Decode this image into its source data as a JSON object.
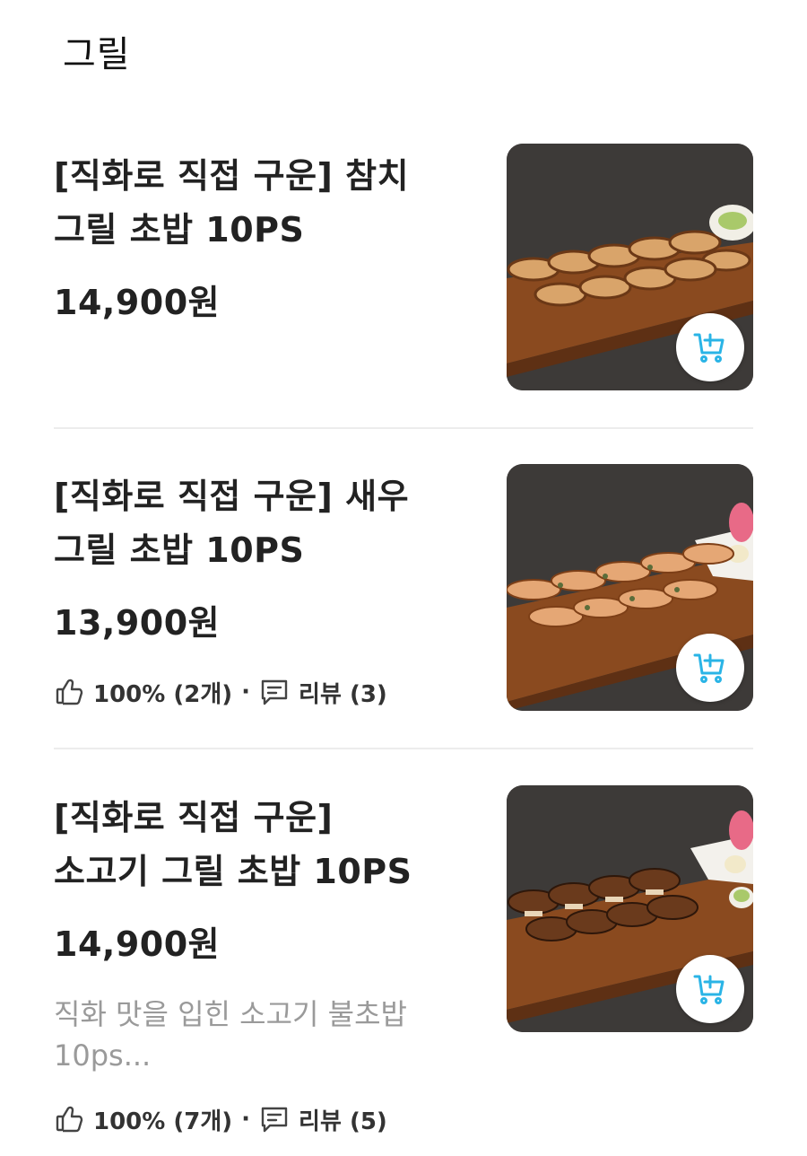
{
  "section": {
    "title": "그릴"
  },
  "colors": {
    "accent": "#2ab4e6",
    "text": "#222222",
    "muted": "#9a9a9a",
    "divider": "#ececec"
  },
  "items": [
    {
      "name_lines": [
        "[직화로 직접 구운] 참치",
        "그릴 초밥 10PS"
      ],
      "price": "14,900원",
      "image": "tuna-grill-sushi-photo"
    },
    {
      "name_lines": [
        "[직화로 직접 구운] 새우",
        "그릴 초밥 10PS"
      ],
      "price": "13,900원",
      "rating": "100% (2개)",
      "reviews": "리뷰 (3)",
      "image": "shrimp-grill-sushi-photo"
    },
    {
      "name_lines": [
        "[직화로 직접 구운]",
        "소고기 그릴 초밥 10PS"
      ],
      "price": "14,900원",
      "description_lines": [
        "직화 맛을 입힌 소고기 불초밥",
        "10ps..."
      ],
      "rating": "100% (7개)",
      "reviews": "리뷰 (5)",
      "image": "beef-grill-sushi-photo"
    }
  ],
  "icons": {
    "thumbs_up": "thumbs-up-icon",
    "review": "review-icon",
    "cart_add": "cart-add-icon"
  }
}
